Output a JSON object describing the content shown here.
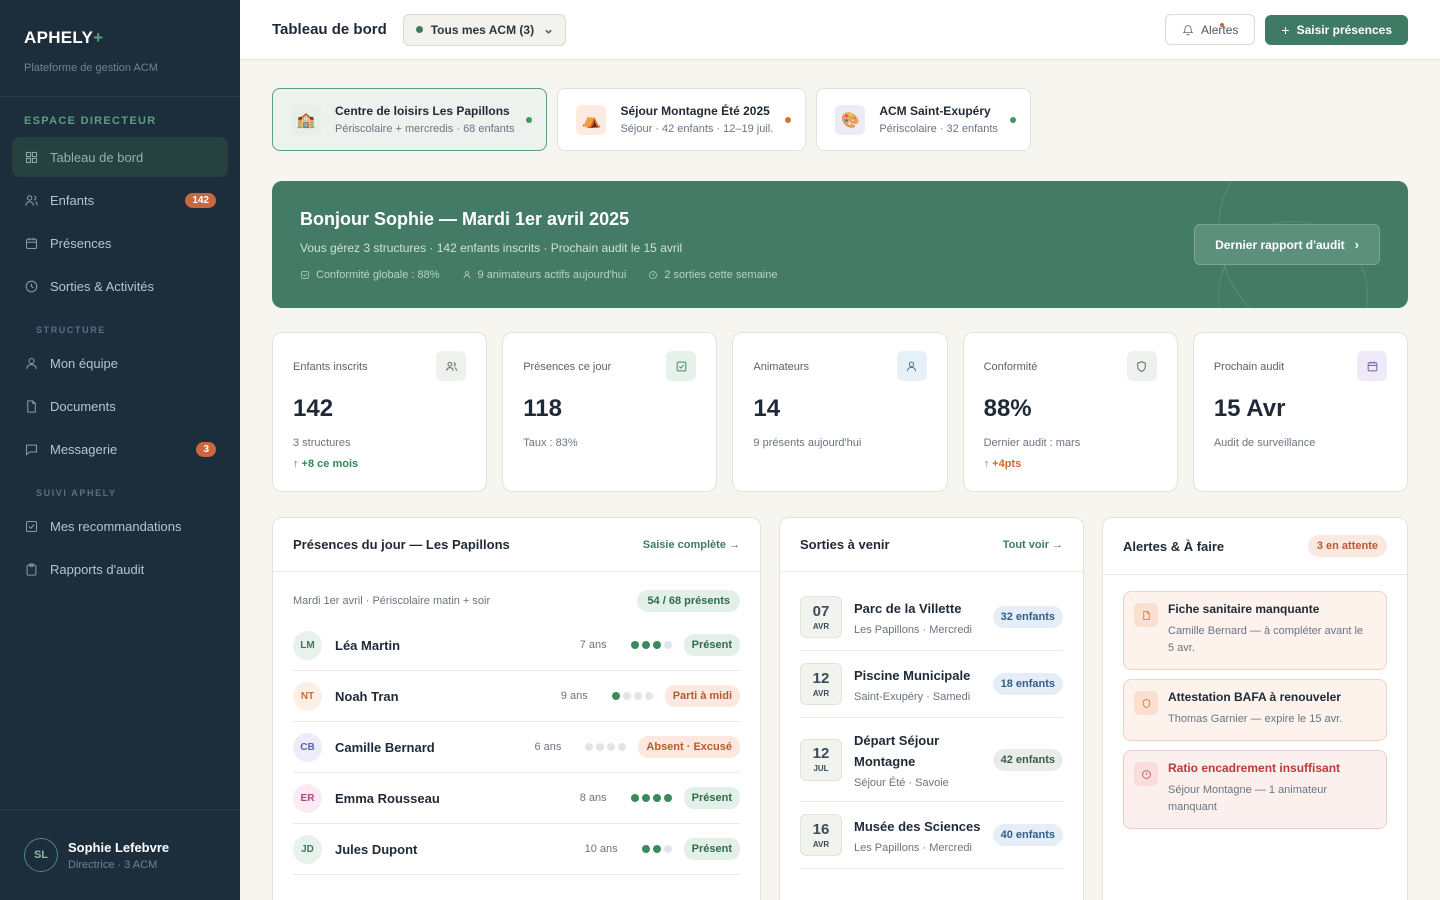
{
  "brand": {
    "name": "APHELY",
    "plus": "+",
    "subtitle": "Plateforme de gestion ACM"
  },
  "sidebar": {
    "section_main": "ESPACE DIRECTEUR",
    "items_main": [
      {
        "label": "Tableau de bord",
        "icon": "grid-icon",
        "active": true
      },
      {
        "label": "Enfants",
        "icon": "users-icon",
        "badge": "142"
      },
      {
        "label": "Présences",
        "icon": "calendar-icon"
      },
      {
        "label": "Sorties & Activités",
        "icon": "clock-icon"
      }
    ],
    "section_structure": "STRUCTURE",
    "items_structure": [
      {
        "label": "Mon équipe",
        "icon": "user-icon"
      },
      {
        "label": "Documents",
        "icon": "document-icon"
      },
      {
        "label": "Messagerie",
        "icon": "message-icon",
        "badge": "3"
      }
    ],
    "section_suivi": "SUIVI APHELY",
    "items_suivi": [
      {
        "label": "Mes recommandations",
        "icon": "checkbox-icon"
      },
      {
        "label": "Rapports d'audit",
        "icon": "clipboard-icon"
      }
    ],
    "user": {
      "initials": "SL",
      "name": "Sophie Lefebvre",
      "role": "Directrice · 3 ACM"
    }
  },
  "topbar": {
    "title": "Tableau de bord",
    "acm_select": "Tous mes ACM (3)",
    "alerts_label": "Alertes",
    "primary_label": "Saisir présences",
    "primary_plus": "+"
  },
  "structures": [
    {
      "title": "Centre de loisirs Les Papillons",
      "sub": "Périscolaire + mercredis · 68 enfants",
      "emoji": "🏫",
      "icon_bg": "#e6efe9",
      "dot": "#3e9a64",
      "active": true
    },
    {
      "title": "Séjour Montagne Été 2025",
      "sub": "Séjour · 42 enfants · 12–19 juil.",
      "emoji": "⛺",
      "icon_bg": "#fbeadf",
      "dot": "#d7722f"
    },
    {
      "title": "ACM Saint-Exupéry",
      "sub": "Périscolaire · 32 enfants",
      "emoji": "🎨",
      "icon_bg": "#ecebf6",
      "dot": "#3e9a64"
    }
  ],
  "banner": {
    "title": "Bonjour Sophie — Mardi 1er avril 2025",
    "subtitle": "Vous gérez 3 structures · 142 enfants inscrits · Prochain audit le 15 avril",
    "meta": [
      {
        "text": "Conformité globale : 88%",
        "icon": "check-square-icon"
      },
      {
        "text": "9 animateurs actifs aujourd'hui",
        "icon": "user-icon"
      },
      {
        "text": "2 sorties cette semaine",
        "icon": "clock-icon"
      }
    ],
    "button": "Dernier rapport d'audit",
    "button_arrow": "›"
  },
  "stats": [
    {
      "label": "Enfants inscrits",
      "value": "142",
      "sub": "3 structures",
      "trend": "↑ +8 ce mois",
      "trend_color": "#2f8a55",
      "icon": "users-icon",
      "icon_bg": "#eef1ee",
      "icon_color": "#5a6a66"
    },
    {
      "label": "Présences ce jour",
      "value": "118",
      "sub": "Taux : 83%",
      "trend": "",
      "trend_color": "#2f8a55",
      "icon": "check-square-icon",
      "icon_bg": "#e6f1ea",
      "icon_color": "#3e8a60"
    },
    {
      "label": "Animateurs",
      "value": "14",
      "sub": "9 présents aujourd'hui",
      "trend": "",
      "trend_color": "#2f8a55",
      "icon": "user-icon",
      "icon_bg": "#e7f0f6",
      "icon_color": "#3b6f96"
    },
    {
      "label": "Conformité",
      "value": "88%",
      "sub": "Dernier audit : mars",
      "trend": "↑ +4pts",
      "trend_color": "#d0672d",
      "icon": "shield-icon",
      "icon_bg": "#eef1ee",
      "icon_color": "#4f6a60"
    },
    {
      "label": "Prochain audit",
      "value": "15 Avr",
      "sub": "Audit de surveillance",
      "trend": "",
      "trend_color": "#2f8a55",
      "icon": "calendar-icon",
      "icon_bg": "#efeaf7",
      "icon_color": "#7a5aa8"
    }
  ],
  "presences": {
    "title": "Présences du jour — Les Papillons",
    "link": "Saisie complète →",
    "meta": "Mardi 1er avril · Périscolaire matin + soir",
    "count": "54 / 68 présents",
    "rows": [
      {
        "initials": "LM",
        "name": "Léa Martin",
        "age": "7 ans",
        "dots": 3,
        "total": 4,
        "status": "Présent",
        "type": "present",
        "av_bg": "#e8f2ec",
        "av_color": "#3e7a62"
      },
      {
        "initials": "NT",
        "name": "Noah Tran",
        "age": "9 ans",
        "dots": 1,
        "total": 4,
        "status": "Parti à midi",
        "type": "midi",
        "av_bg": "#fcefe5",
        "av_color": "#c2703a"
      },
      {
        "initials": "CB",
        "name": "Camille Bernard",
        "age": "6 ans",
        "dots": 0,
        "total": 4,
        "status": "Absent · Excusé",
        "type": "absent",
        "av_bg": "#ecedf9",
        "av_color": "#5b62b0"
      },
      {
        "initials": "ER",
        "name": "Emma Rousseau",
        "age": "8 ans",
        "dots": 4,
        "total": 4,
        "status": "Présent",
        "type": "present",
        "av_bg": "#fbe9f3",
        "av_color": "#b04a86"
      },
      {
        "initials": "JD",
        "name": "Jules Dupont",
        "age": "10 ans",
        "dots": 2,
        "total": 3,
        "status": "Présent",
        "type": "present",
        "av_bg": "#e8f2ec",
        "av_color": "#3e7a62"
      }
    ]
  },
  "sorties": {
    "title": "Sorties à venir",
    "link": "Tout voir →",
    "rows": [
      {
        "day": "07",
        "month": "AVR",
        "title": "Parc de la Villette",
        "sub": "Les Papillons · Mercredi",
        "count": "32 enfants",
        "pill": "blue"
      },
      {
        "day": "12",
        "month": "AVR",
        "title": "Piscine Municipale",
        "sub": "Saint-Exupéry · Samedi",
        "count": "18 enfants",
        "pill": "blue"
      },
      {
        "day": "12",
        "month": "JUL",
        "title": "Départ Séjour Montagne",
        "sub": "Séjour Été · Savoie",
        "count": "42 enfants",
        "pill": "grey"
      },
      {
        "day": "16",
        "month": "AVR",
        "title": "Musée des Sciences",
        "sub": "Les Papillons · Mercredi",
        "count": "40 enfants",
        "pill": "blue"
      }
    ]
  },
  "alerts": {
    "title": "Alertes & À faire",
    "pending": "3 en attente",
    "items": [
      {
        "title": "Fiche sanitaire manquante",
        "text": "Camille Bernard — à compléter avant le 5 avr.",
        "icon": "document-icon",
        "tone": "orange"
      },
      {
        "title": "Attestation BAFA à renouveler",
        "text": "Thomas Garnier — expire le 15 avr.",
        "icon": "shield-icon",
        "tone": "orange"
      },
      {
        "title": "Ratio encadrement insuffisant",
        "text": "Séjour Montagne — 1 animateur manquant",
        "icon": "alert-circle-icon",
        "tone": "red"
      }
    ]
  }
}
